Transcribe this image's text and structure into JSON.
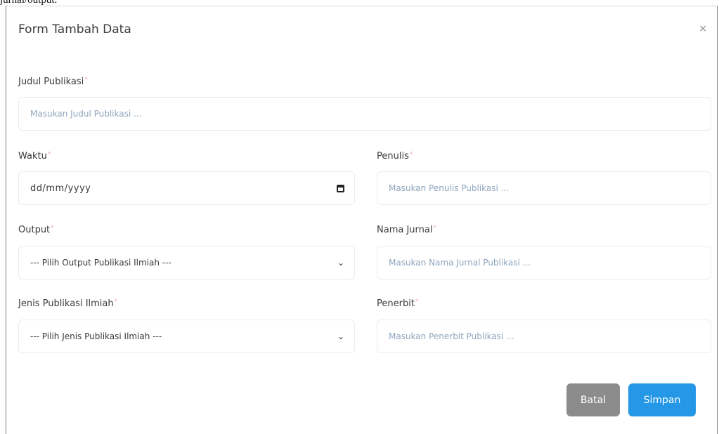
{
  "page": {
    "caption": "jurnal/output."
  },
  "modal": {
    "title": "Form Tambah Data",
    "close_symbol": "×",
    "required_mark": "*"
  },
  "fields": {
    "judul": {
      "label": "Judul Publikasi",
      "placeholder": "Masukan Judul Publikasi ..."
    },
    "waktu": {
      "label": "Waktu",
      "value": "dd/mm/yyyy"
    },
    "penulis": {
      "label": "Penulis",
      "placeholder": "Masukan Penulis Publikasi ..."
    },
    "output": {
      "label": "Output",
      "selected": "--- Pilih Output Publikasi Ilmiah ---"
    },
    "nama_jurnal": {
      "label": "Nama Jurnal",
      "placeholder": "Masukan Nama Jurnal Publikasi ..."
    },
    "jenis": {
      "label": "Jenis Publikasi Ilmiah",
      "selected": "--- Pilih Jenis Publikasi Ilmiah ---"
    },
    "penerbit": {
      "label": "Penerbit",
      "placeholder": "Masukan Penerbit Publikasi ..."
    }
  },
  "buttons": {
    "cancel": "Batal",
    "save": "Simpan"
  },
  "icons": {
    "close": "close-icon",
    "calendar": "calendar-icon",
    "chevron": "chevron-down-icon"
  },
  "colors": {
    "primary": "#2497e6",
    "secondary": "#8c8c8c",
    "required": "#e8b0b8",
    "placeholder": "#8fa6bd"
  }
}
